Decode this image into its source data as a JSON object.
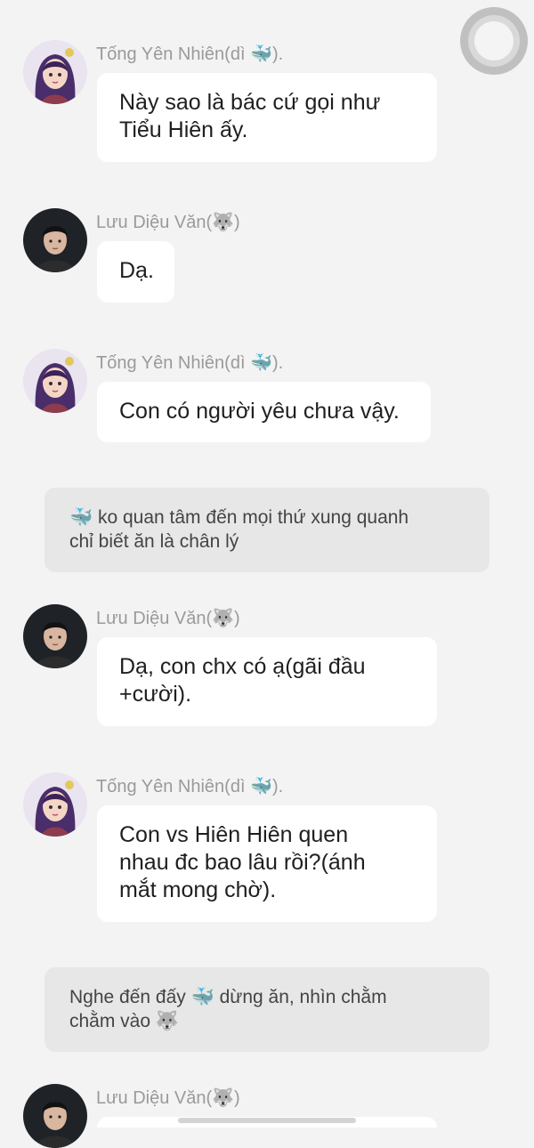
{
  "messages": [
    {
      "kind": "chat",
      "sender": "Tống Yên Nhiên(dì 🐳).",
      "avatar": "woman-avatar",
      "text_lines": [
        "Này sao là bác cứ gọi như",
        "Tiểu Hiên ấy."
      ]
    },
    {
      "kind": "chat",
      "sender": "Lưu Diệu Văn(🐺)",
      "avatar": "man-avatar",
      "text_lines": [
        "Dạ."
      ]
    },
    {
      "kind": "chat",
      "sender": "Tống Yên Nhiên(dì 🐳).",
      "avatar": "woman-avatar",
      "text_lines": [
        "Con có người yêu chưa vậy."
      ]
    },
    {
      "kind": "narration",
      "text_lines": [
        "🐳 ko quan tâm đến mọi thứ xung quanh",
        "chỉ biết ăn là chân lý"
      ]
    },
    {
      "kind": "chat",
      "sender": "Lưu Diệu Văn(🐺)",
      "avatar": "man-avatar",
      "text_lines": [
        "Dạ, con chx có ạ(gãi đầu",
        "+cười)."
      ]
    },
    {
      "kind": "chat",
      "sender": "Tống Yên Nhiên(dì 🐳).",
      "avatar": "woman-avatar",
      "text_lines": [
        "Con vs Hiên Hiên quen",
        "nhau đc bao lâu rồi?(ánh",
        "mắt mong chờ)."
      ]
    },
    {
      "kind": "narration",
      "text_lines": [
        "Nghe đến đấy 🐳 dừng ăn, nhìn chằm",
        "chằm vào 🐺"
      ]
    },
    {
      "kind": "chat",
      "sender": "Lưu Diệu Văn(🐺)",
      "avatar": "man-avatar",
      "text_lines": []
    }
  ],
  "colors": {
    "background": "#f3f3f3",
    "bubble": "#ffffff",
    "narration": "#e7e7e7",
    "sender": "#9a9a9a"
  }
}
